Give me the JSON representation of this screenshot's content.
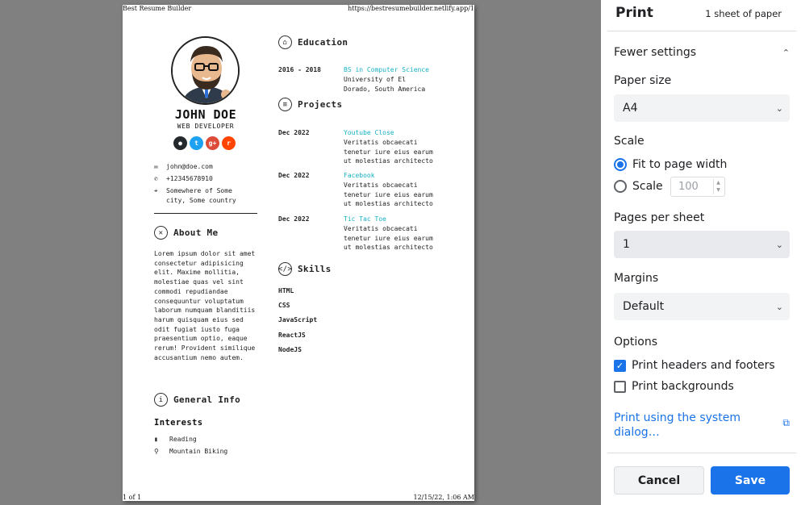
{
  "preview": {
    "header_left": "Best Resume Builder",
    "header_right": "https://bestresumebuilder.netlify.app/1",
    "footer_left": "1 of 1",
    "footer_right": "12/15/22, 1:06 AM"
  },
  "resume": {
    "name": "JOHN DOE",
    "role": "WEB DEVELOPER",
    "socials": [
      {
        "icon": "github-icon",
        "glyph": "●",
        "color": "#24292e"
      },
      {
        "icon": "twitter-icon",
        "glyph": "t",
        "color": "#1da1f2"
      },
      {
        "icon": "google-plus-icon",
        "glyph": "g+",
        "color": "#dd4b39"
      },
      {
        "icon": "reddit-icon",
        "glyph": "r",
        "color": "#ff4500"
      }
    ],
    "contact": {
      "email": "john@doe.com",
      "phone": "+12345678910",
      "address_line1": "Somewhere of Some",
      "address_line2": "city, Some country"
    },
    "about_title": "About Me",
    "about_text": "Lorem ipsum dolor sit amet consectetur adipisicing elit. Maxime mollitia, molestiae quas vel sint commodi repudiandae consequuntur voluptatum laborum numquam blanditiis harum quisquam eius sed odit fugiat iusto fuga praesentium optio, eaque rerum! Provident similique accusantium nemo autem.",
    "general_title": "General Info",
    "interests_title": "Interests",
    "interests": [
      "Reading",
      "Mountain Biking"
    ],
    "education_title": "Education",
    "education": {
      "dates": "2016 - 2018",
      "degree": "BS in Computer Science",
      "school_line1": "University of El",
      "school_line2": "Dorado, South America"
    },
    "projects_title": "Projects",
    "projects": [
      {
        "date": "Dec 2022",
        "title": "Youtube Close",
        "l1": "Veritatis obcaecati",
        "l2": "tenetur iure eius earum",
        "l3": "ut molestias architecto"
      },
      {
        "date": "Dec 2022",
        "title": "Facebook",
        "l1": "Veritatis obcaecati",
        "l2": "tenetur iure eius earum",
        "l3": "ut molestias architecto"
      },
      {
        "date": "Dec 2022",
        "title": "Tic Tac Toe",
        "l1": "Veritatis obcaecati",
        "l2": "tenetur iure eius earum",
        "l3": "ut molestias architecto"
      }
    ],
    "skills_title": "Skills",
    "skills": [
      "HTML",
      "CSS",
      "JavaScript",
      "ReactJS",
      "NodeJS"
    ]
  },
  "print": {
    "title": "Print",
    "sheets": "1 sheet of paper",
    "fewer_settings": "Fewer settings",
    "paper_size_label": "Paper size",
    "paper_size_value": "A4",
    "scale_label": "Scale",
    "fit_option": "Fit to page width",
    "scale_option": "Scale",
    "scale_placeholder": "100",
    "pages_label": "Pages per sheet",
    "pages_value": "1",
    "margins_label": "Margins",
    "margins_value": "Default",
    "options_label": "Options",
    "headers_footers": "Print headers and footers",
    "backgrounds": "Print backgrounds",
    "system_dialog": "Print using the system dialog…",
    "cancel": "Cancel",
    "save": "Save"
  }
}
